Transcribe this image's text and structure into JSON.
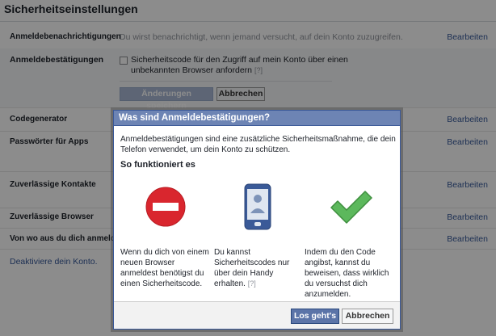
{
  "page": {
    "title": "Sicherheitseinstellungen",
    "deactivate_link": "Deaktiviere dein Konto."
  },
  "settings": {
    "edit_label": "Bearbeiten",
    "rows": [
      {
        "label": "Anmeldebenachrichtigungen",
        "description": "Du wirst benachrichtigt, wenn jemand versucht, auf dein Konto zuzugreifen."
      },
      {
        "label": "Anmeldebestätigungen"
      },
      {
        "label": "Codegenerator"
      },
      {
        "label": "Passwörter für Apps"
      },
      {
        "label": "Zuverlässige Kontakte"
      },
      {
        "label": "Zuverlässige Browser"
      },
      {
        "label": "Von wo aus du dich anmeldest"
      }
    ],
    "login_approvals": {
      "checkbox_label": "Sicherheitscode für den Zugriff auf mein Konto über einen unbekannten Browser anfordern",
      "help": "[?]",
      "save_button": "Änderungen speichern",
      "cancel_button": "Abbrechen",
      "checked": false
    }
  },
  "dialog": {
    "title": "Was sind Anmeldebestätigungen?",
    "intro": "Anmeldebestätigungen sind eine zusätzliche Sicherheitsmaßnahme, die dein Telefon verwendet, um dein Konto zu schützen.",
    "subheading": "So funktioniert es",
    "steps": [
      {
        "icon": "stop-sign-icon",
        "text": "Wenn du dich von einem neuen Browser anmeldest benötigst du einen Sicherheitscode."
      },
      {
        "icon": "mobile-phone-icon",
        "text": "Du kannst Sicherheitscodes nur über dein Handy erhalten.",
        "help": "[?]"
      },
      {
        "icon": "checkmark-icon",
        "text": "Indem du den Code angibst, kannst du beweisen, dass wirklich du versuchst dich anzumelden."
      }
    ],
    "primary_button": "Los geht's",
    "cancel_button": "Abbrechen"
  },
  "colors": {
    "link": "#365899",
    "dialog_header": "#6d84b4",
    "primary_button": "#5b74a8",
    "stop_red": "#d9262e",
    "check_green": "#5cb85c"
  }
}
